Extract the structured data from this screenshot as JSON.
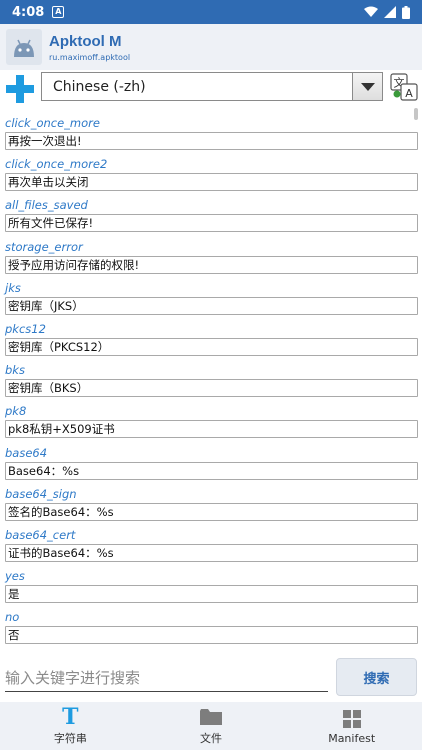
{
  "status_bar": {
    "time": "4:08",
    "notification_letter": "A"
  },
  "app": {
    "name": "Apktool M",
    "package": "ru.maximoff.apktool"
  },
  "language": {
    "selected": "Chinese (-zh)"
  },
  "strings": [
    {
      "key": "click_once_more",
      "value": "再按一次退出!"
    },
    {
      "key": "click_once_more2",
      "value": "再次单击以关闭"
    },
    {
      "key": "all_files_saved",
      "value": "所有文件已保存!"
    },
    {
      "key": "storage_error",
      "value": "授予应用访问存储的权限!"
    },
    {
      "key": "jks",
      "value": "密钥库（JKS）"
    },
    {
      "key": "pkcs12",
      "value": "密钥库（PKCS12）"
    },
    {
      "key": "bks",
      "value": "密钥库（BKS）"
    },
    {
      "key": "pk8",
      "value": "pk8私钥+X509证书"
    },
    {
      "key": "base64",
      "value": "Base64：%s"
    },
    {
      "key": "base64_sign",
      "value": "签名的Base64：%s"
    },
    {
      "key": "base64_cert",
      "value": "证书的Base64：%s"
    },
    {
      "key": "yes",
      "value": "是"
    },
    {
      "key": "no",
      "value": "否"
    }
  ],
  "search": {
    "placeholder": "输入关键字进行搜索",
    "button_label": "搜索"
  },
  "bottom_nav": {
    "tabs": [
      {
        "label": "字符串",
        "icon": "text-t-icon"
      },
      {
        "label": "文件",
        "icon": "folder-icon"
      },
      {
        "label": "Manifest",
        "icon": "grid-icon"
      }
    ]
  },
  "colors": {
    "accent": "#2f6bb3",
    "key_text": "#2e79c7",
    "plus": "#1e9be0"
  }
}
